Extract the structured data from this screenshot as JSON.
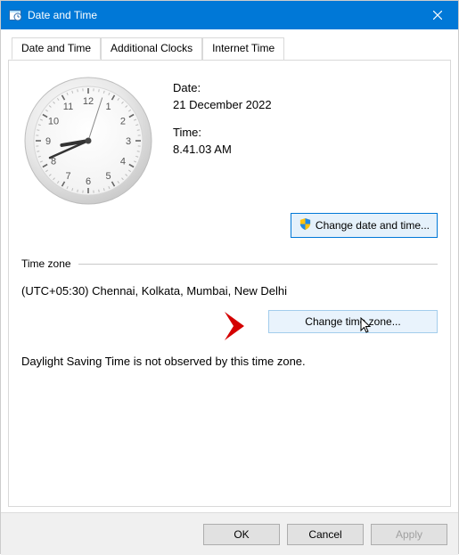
{
  "window": {
    "title": "Date and Time"
  },
  "tabs": {
    "t0": "Date and Time",
    "t1": "Additional Clocks",
    "t2": "Internet Time"
  },
  "datetime": {
    "date_label": "Date:",
    "date_value": "21 December 2022",
    "time_label": "Time:",
    "time_value": "8.41.03 AM",
    "change_btn": "Change date and time...",
    "clock_hour": 8,
    "clock_minute": 41,
    "clock_second": 3
  },
  "timezone": {
    "section_title": "Time zone",
    "value": "(UTC+05:30) Chennai, Kolkata, Mumbai, New Delhi",
    "change_btn": "Change time zone...",
    "dst_note": "Daylight Saving Time is not observed by this time zone."
  },
  "buttons": {
    "ok": "OK",
    "cancel": "Cancel",
    "apply": "Apply"
  }
}
